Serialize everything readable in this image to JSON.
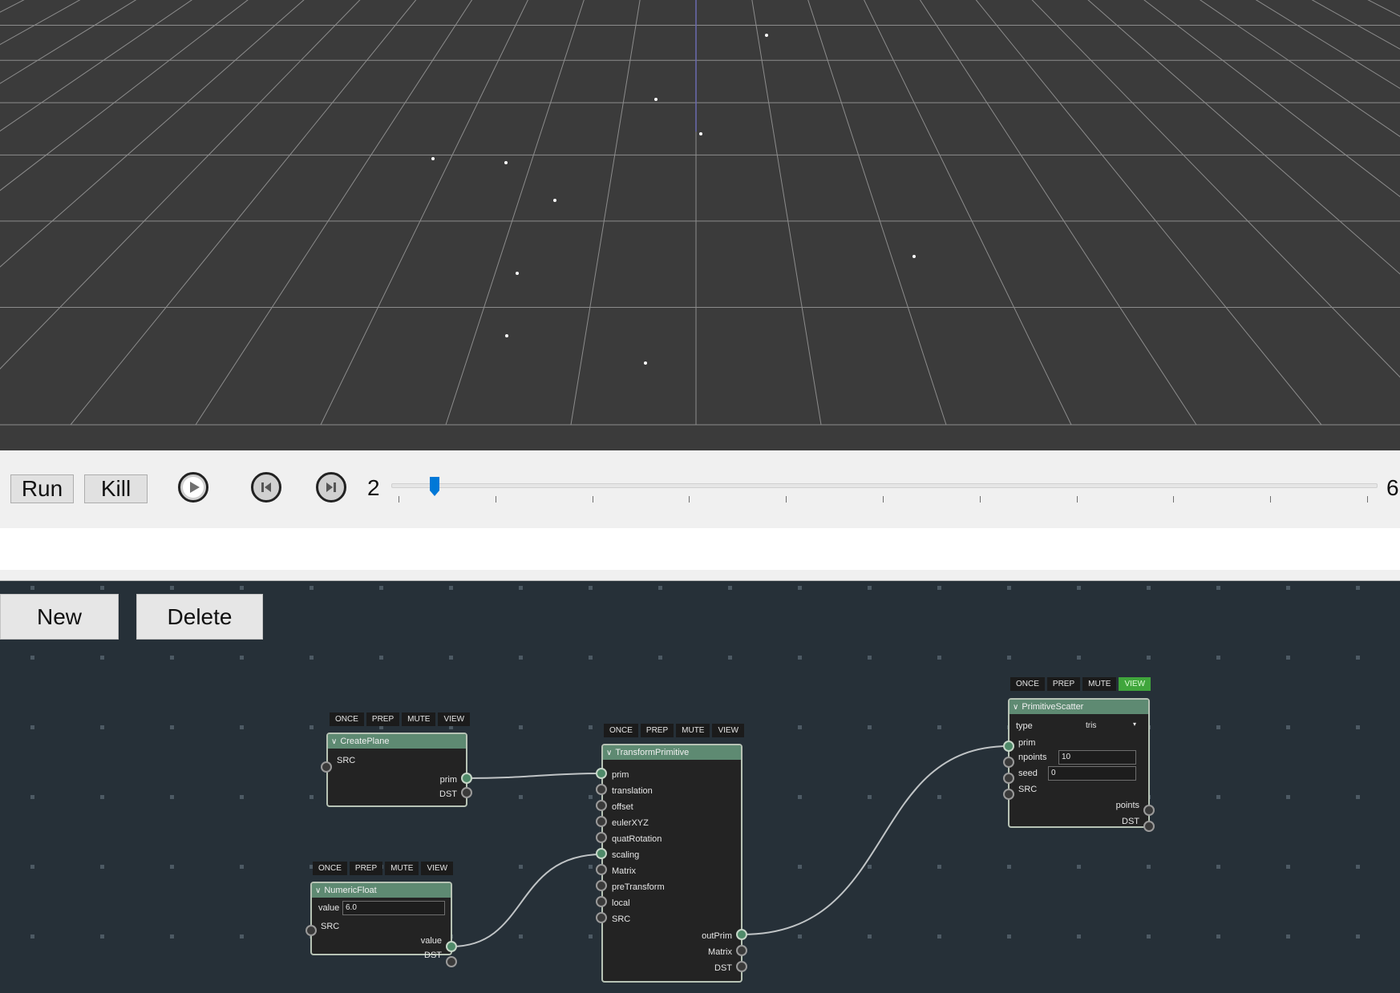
{
  "timeline": {
    "run_label": "Run",
    "kill_label": "Kill",
    "current_frame": "2",
    "end_frame": "6",
    "slider_fraction": 0.02
  },
  "editor": {
    "new_label": "New",
    "delete_label": "Delete",
    "toolbar_buttons": [
      "ONCE",
      "PREP",
      "MUTE",
      "VIEW"
    ],
    "nodes": {
      "create_plane": {
        "title": "CreatePlane",
        "inputs": [
          "SRC"
        ],
        "outputs": [
          "prim",
          "DST"
        ]
      },
      "numeric_float": {
        "title": "NumericFloat",
        "value_label": "value",
        "value": "6.0",
        "inputs": [
          "SRC"
        ],
        "outputs": [
          "value",
          "DST"
        ]
      },
      "transform_primitive": {
        "title": "TransformPrimitive",
        "inputs": [
          "prim",
          "translation",
          "offset",
          "eulerXYZ",
          "quatRotation",
          "scaling",
          "Matrix",
          "preTransform",
          "local",
          "SRC"
        ],
        "outputs": [
          "outPrim",
          "Matrix",
          "DST"
        ]
      },
      "primitive_scatter": {
        "title": "PrimitiveScatter",
        "type_label": "type",
        "type_value": "tris",
        "inputs": [
          "prim",
          "npoints",
          "seed",
          "SRC"
        ],
        "npoints_value": "10",
        "seed_value": "0",
        "outputs": [
          "points",
          "DST"
        ],
        "view_active": true
      }
    }
  },
  "colors": {
    "viewport_bg": "#3b3b3b",
    "editor_bg": "#263038",
    "node_header": "#5e8a72",
    "view_active": "#40a63c",
    "slider_handle": "#0078d7"
  },
  "icons": [
    "play-icon",
    "step-back-icon",
    "step-forward-icon",
    "chevron-down-icon"
  ]
}
